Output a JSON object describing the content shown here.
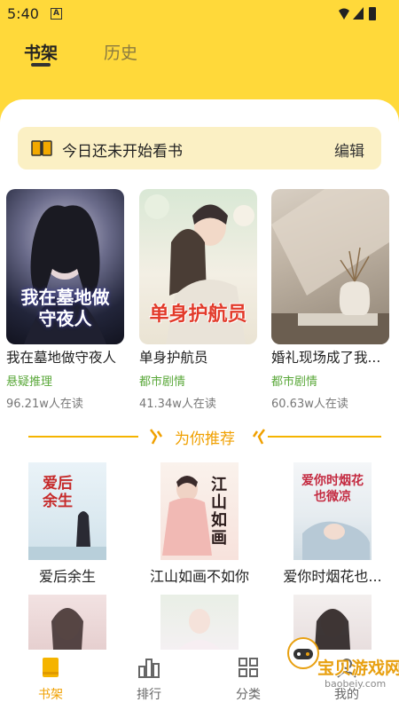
{
  "status": {
    "time": "5:40",
    "notif_badge": "A"
  },
  "header": {
    "tabs": [
      {
        "label": "书架"
      },
      {
        "label": "历史"
      }
    ]
  },
  "notice": {
    "text": "今日还未开始看书",
    "edit_label": "编辑"
  },
  "shelf": {
    "books": [
      {
        "title": "我在墓地做守夜人",
        "cover_text": "我在墓地做守夜人",
        "genre": "悬疑推理",
        "readers": "96.21w人在读"
      },
      {
        "title": "单身护航员",
        "cover_text": "单身护航员",
        "genre": "都市剧情",
        "readers": "41.34w人在读"
      },
      {
        "title": "婚礼现场成了我...",
        "cover_text": "",
        "genre": "都市剧情",
        "readers": "60.63w人在读"
      }
    ]
  },
  "recommend": {
    "title": "为你推荐",
    "books": [
      {
        "title": "爱后余生",
        "cover_text": "爱后余生"
      },
      {
        "title": "江山如画不如你",
        "cover_text": "江山如画"
      },
      {
        "title": "爱你时烟花也...",
        "cover_text": "爱你时烟花也微凉"
      }
    ]
  },
  "bottom_nav": {
    "items": [
      {
        "label": "书架",
        "icon": "book-icon"
      },
      {
        "label": "排行",
        "icon": "ranking-icon"
      },
      {
        "label": "分类",
        "icon": "category-icon"
      },
      {
        "label": "我的",
        "icon": "profile-icon"
      }
    ]
  },
  "watermark": {
    "text": "宝贝游戏网",
    "url": "baobeiy.com"
  },
  "colors": {
    "brand_yellow": "#ffd93a",
    "accent_orange": "#f0a000",
    "genre_green": "#5aa83a"
  }
}
